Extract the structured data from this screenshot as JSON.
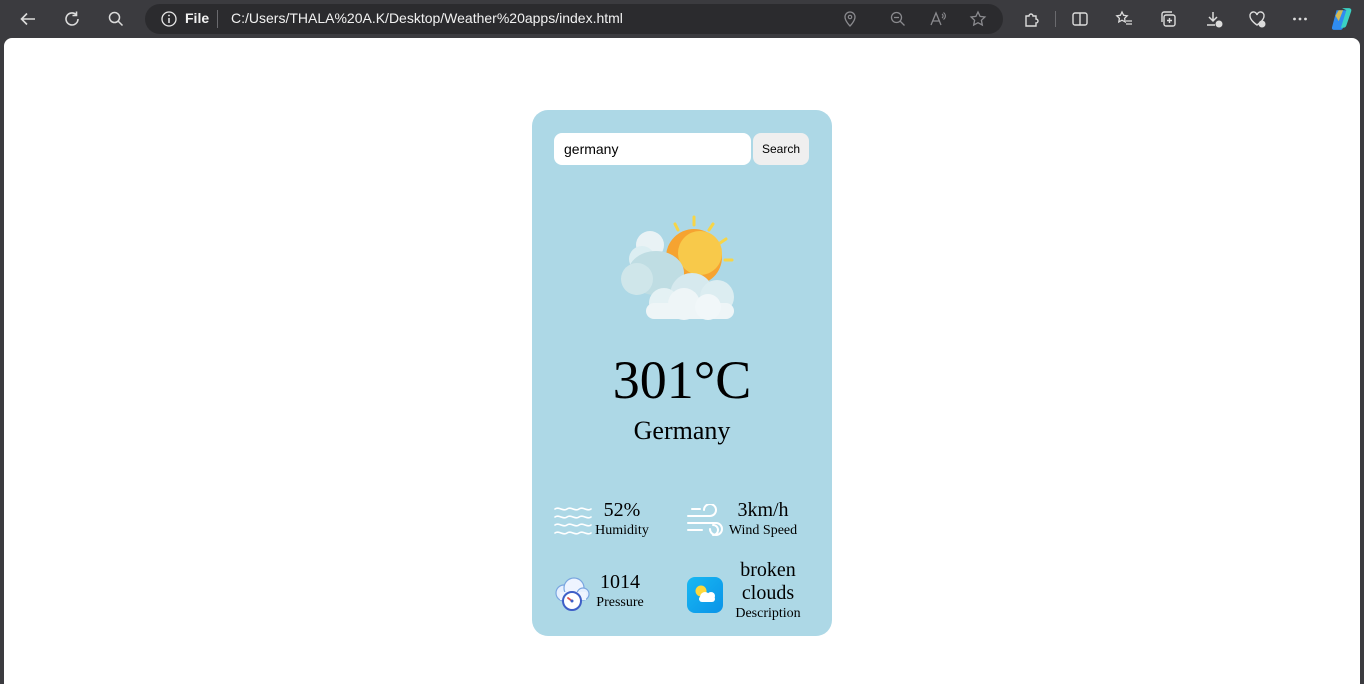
{
  "browser": {
    "file_label": "File",
    "url": "C:/Users/THALA%20A.K/Desktop/Weather%20apps/index.html"
  },
  "weather": {
    "search_value": "germany",
    "search_button": "Search",
    "icon": "partly-cloudy-sun-icon",
    "temperature": "301°C",
    "city": "Germany",
    "humidity_value": "52%",
    "humidity_label": "Humidity",
    "wind_value": "3km/h",
    "wind_label": "Wind Speed",
    "pressure_value": "1014",
    "pressure_label": "Pressure",
    "description_value": "broken clouds",
    "description_label": "Description"
  },
  "colors": {
    "card_background": "#add8e6",
    "browser_chrome": "#3b3b3f"
  }
}
